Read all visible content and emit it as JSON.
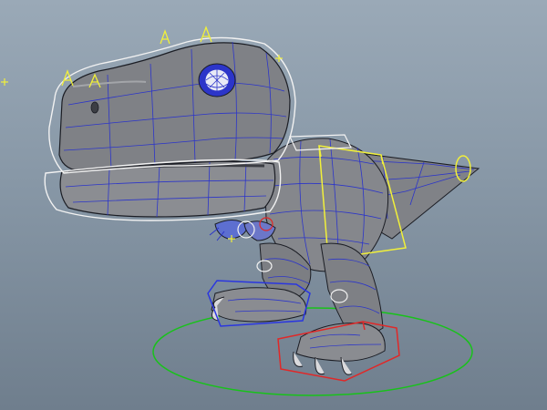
{
  "scene": {
    "subject": "dinosaur-wireframe-rig",
    "icons": [
      "locator-cross-icon",
      "control-curve-icon",
      "ground-ring-control-icon"
    ]
  },
  "colors": {
    "viewport_bg_top": "#9aa9b7",
    "viewport_bg_bottom": "#6f7e8d",
    "mesh_fill": "#7d7f84",
    "mesh_light": "#a3a5a9",
    "mesh_dark": "#4b4d52",
    "wireframe": "#2c35c9",
    "edge": "#1b1d24",
    "control_white": "#f2f2f2",
    "control_yellow": "#f1f03a",
    "control_red": "#e02828",
    "control_green": "#18c21a",
    "control_blue": "#2a36e0"
  }
}
